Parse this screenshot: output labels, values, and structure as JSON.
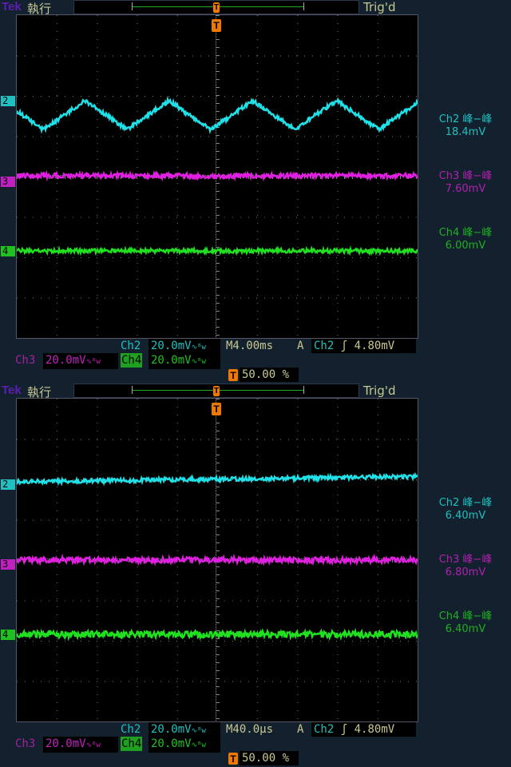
{
  "panels": [
    {
      "brand": "Tek",
      "run_state": "執行",
      "trigger_status": "Trig'd",
      "measurements": [
        {
          "label": "Ch2 峰−峰",
          "value": "18.4mV",
          "color": "#20c0c0"
        },
        {
          "label": "Ch3 峰−峰",
          "value": "7.60mV",
          "color": "#b020b0"
        },
        {
          "label": "Ch4 峰−峰",
          "value": "6.00mV",
          "color": "#20b020"
        }
      ],
      "ch2": {
        "label": "Ch2",
        "scale": "20.0mV",
        "bw": "∿ᴮw"
      },
      "ch3": {
        "label": "Ch3",
        "scale": "20.0mV",
        "bw": "∿ᴮw"
      },
      "ch4": {
        "label": "Ch4",
        "scale": "20.0mV",
        "bw": "∿ᴮw"
      },
      "timebase": "M4.00ms",
      "trigger": {
        "mode": "A",
        "source": "Ch2",
        "slope": "ʃ",
        "level": "4.80mV"
      },
      "trigger_position": "50.00 %"
    },
    {
      "brand": "Tek",
      "run_state": "執行",
      "trigger_status": "Trig'd",
      "measurements": [
        {
          "label": "Ch2 峰−峰",
          "value": "6.40mV",
          "color": "#20c0c0"
        },
        {
          "label": "Ch3 峰−峰",
          "value": "6.80mV",
          "color": "#b020b0"
        },
        {
          "label": "Ch4 峰−峰",
          "value": "6.40mV",
          "color": "#20b020"
        }
      ],
      "ch2": {
        "label": "Ch2",
        "scale": "20.0mV",
        "bw": "∿ᴮw"
      },
      "ch3": {
        "label": "Ch3",
        "scale": "20.0mV",
        "bw": "∿ᴮw"
      },
      "ch4": {
        "label": "Ch4",
        "scale": "20.0mV",
        "bw": "∿ᴮw"
      },
      "timebase": "M40.0µs",
      "trigger": {
        "mode": "A",
        "source": "Ch2",
        "slope": "ʃ",
        "level": "4.80mV"
      },
      "trigger_position": "50.00 %"
    }
  ],
  "markers": {
    "t": "T",
    "ch2": "2",
    "ch3": "3",
    "ch4": "4"
  },
  "colors": {
    "ch2": "#20e0e8",
    "ch3": "#e020e0",
    "ch4": "#20e020"
  }
}
